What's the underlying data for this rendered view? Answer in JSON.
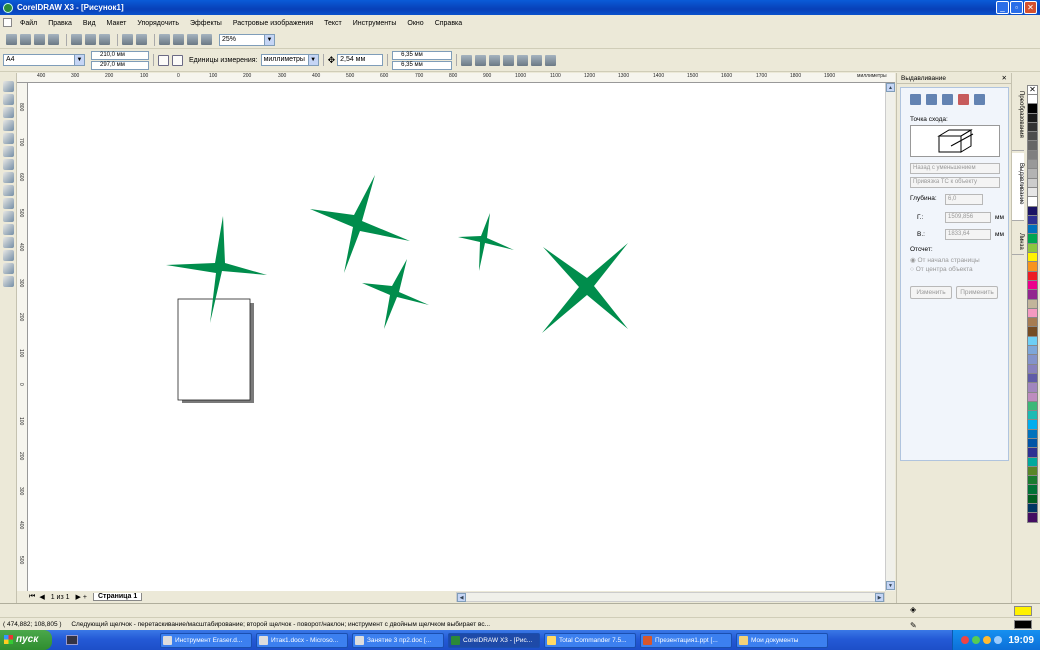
{
  "window": {
    "title": "CorelDRAW X3 - [Рисунок1]"
  },
  "menu": [
    "Файл",
    "Правка",
    "Вид",
    "Макет",
    "Упорядочить",
    "Эффекты",
    "Растровые изображения",
    "Текст",
    "Инструменты",
    "Окно",
    "Справка"
  ],
  "toolbar": {
    "zoom_value": "25%"
  },
  "propertybar": {
    "paper_size": "A4",
    "width": "210,0 мм",
    "height": "297,0 мм",
    "units_label": "Единицы измерения:",
    "units_value": "миллиметры",
    "nudge": "2,54 мм",
    "dup_x": "6,35 мм",
    "dup_y": "6,35 мм"
  },
  "ruler": {
    "h_labels": [
      "400",
      "300",
      "200",
      "100",
      "0",
      "100",
      "200",
      "300",
      "400",
      "500",
      "600",
      "700",
      "800",
      "900",
      "1000",
      "1100",
      "1200",
      "1300",
      "1400",
      "1500",
      "1600",
      "1700",
      "1800",
      "1900"
    ],
    "h_unit": "миллиметры",
    "v_labels": [
      "800",
      "700",
      "600",
      "500",
      "400",
      "300",
      "200",
      "100",
      "0",
      "100",
      "200",
      "300",
      "400",
      "500"
    ],
    "v_unit": "миллиметры"
  },
  "pages": {
    "counter": "1 из 1",
    "active_tab": "Страница 1"
  },
  "docker": {
    "title": "Выдавливание",
    "vanishing_point_label": "Точка схода:",
    "vp_mode": "Назад с уменьшением",
    "vp_lock": "Привязка ТС к объекту",
    "depth_label": "Глубина:",
    "depth_value": "6,0",
    "h_label": "Г.:",
    "h_value": "1509,856",
    "v_label": "В.:",
    "v_value": "1833,64",
    "unit": "мм",
    "origin_label": "Отсчет:",
    "origin_opt1": "От начала страницы",
    "origin_opt2": "От центра объекта",
    "edit_button": "Изменить",
    "apply_button": "Применить"
  },
  "side_tabs": [
    "Преобразования",
    "Выдавливание",
    "Линза"
  ],
  "palette": [
    "#ffffff",
    "#000000",
    "#1a1a1a",
    "#333333",
    "#4d4d4d",
    "#666666",
    "#808080",
    "#999999",
    "#b3b3b3",
    "#cccccc",
    "#e6e6e6",
    "#ffffff",
    "#1b1464",
    "#2e3192",
    "#0071bc",
    "#00a651",
    "#8dc63f",
    "#fff200",
    "#f7941d",
    "#ed1c24",
    "#ec008c",
    "#92278f",
    "#c2b59b",
    "#f49ac1",
    "#a67c52",
    "#754c24",
    "#6dcff6",
    "#7da7d9",
    "#8393ca",
    "#8781bd",
    "#605ca8",
    "#a186be",
    "#bd8cbf",
    "#3cb878",
    "#1cbbb4",
    "#00aeef",
    "#0072bc",
    "#0054a6",
    "#2e3192",
    "#00a99d",
    "#598527",
    "#197b30",
    "#007236",
    "#005e20",
    "#003663",
    "#440e62"
  ],
  "status": {
    "coordinates": "( 474,882; 108,805 )",
    "hint": "Следующий щелчок - перетаскивание/масштабирование; второй щелчок - поворот/наклон; инструмент с двойным щелчком выбирает вс..."
  },
  "taskbar": {
    "start": "пуск",
    "tasks": [
      "Инструмент Eraser.d...",
      "Итак1.docx - Microso...",
      "Занятие 3 пр2.doc [...",
      "CorelDRAW X3 - [Рис...",
      "Total Commander 7.5...",
      "Презентация1.ppt [...",
      "Мои документы"
    ],
    "clock": "19:09"
  },
  "colors": {
    "star_green": "#008d4c",
    "title_blue": "#0a5bd8",
    "taskbar_blue": "#245ad6"
  }
}
